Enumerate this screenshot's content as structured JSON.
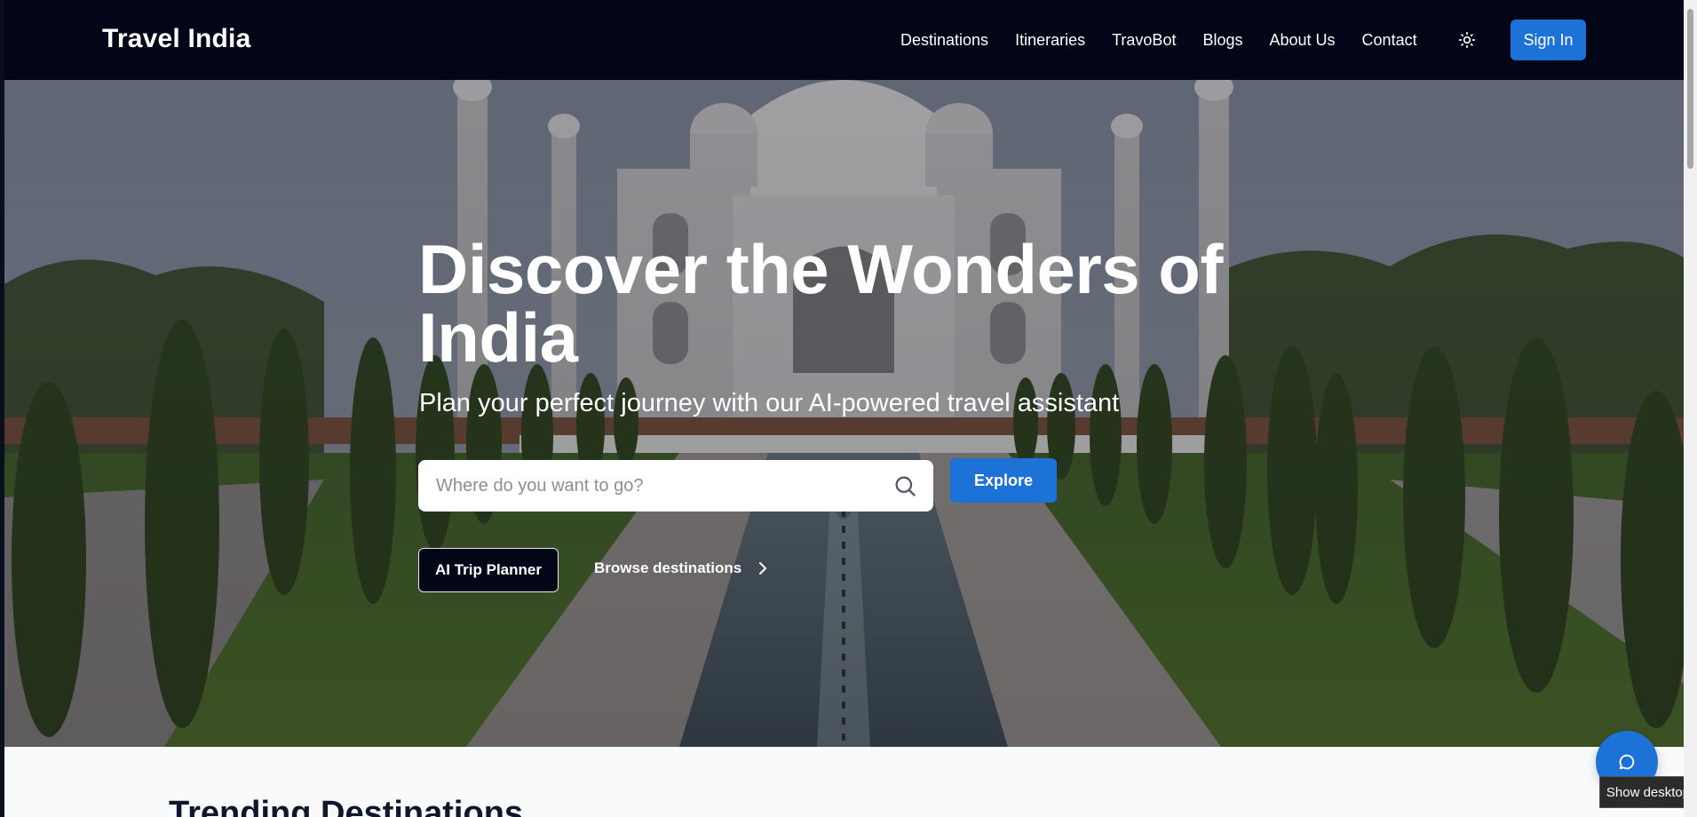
{
  "nav": {
    "brand": "Travel India",
    "links": [
      "Destinations",
      "Itineraries",
      "TravoBot",
      "Blogs",
      "About Us",
      "Contact"
    ],
    "theme_icon": "sun-icon",
    "signin_label": "Sign In"
  },
  "hero": {
    "title": "Discover the Wonders of India",
    "subtitle": "Plan your perfect journey with our AI-powered travel assistant",
    "search_placeholder": "Where do you want to go?",
    "search_value": "",
    "explore_label": "Explore",
    "ai_planner_label": "AI Trip Planner",
    "browse_label": "Browse destinations"
  },
  "trending": {
    "title": "Trending Destinations"
  },
  "chat": {
    "icon": "chat-icon"
  },
  "tooltip": {
    "text": "Show desktop"
  },
  "colors": {
    "nav_bg": "#020617",
    "accent": "#1d72d8",
    "page_bg": "#f8fafc"
  }
}
